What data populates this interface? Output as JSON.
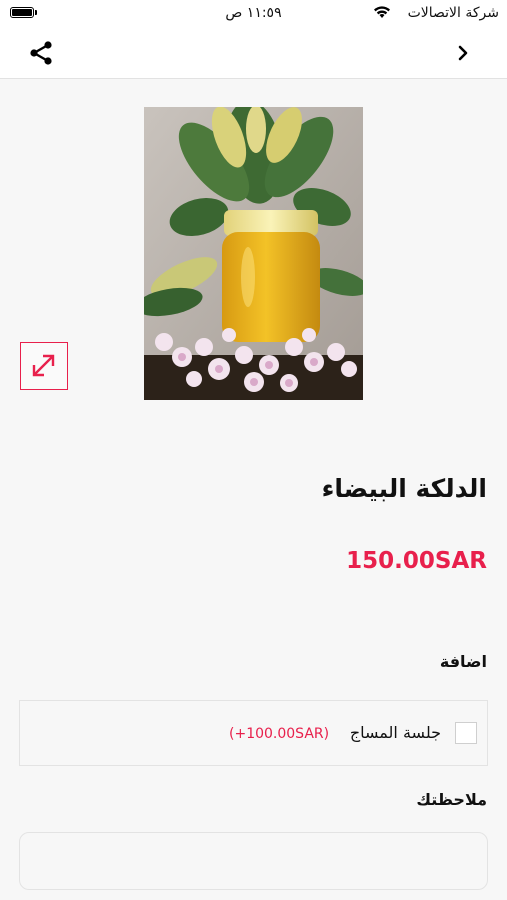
{
  "status_bar": {
    "carrier": "شركة الاتصالات",
    "time": "١١:٥٩ ص"
  },
  "nav": {
    "share_icon": "share-icon",
    "back_icon": "chevron-right-icon"
  },
  "product": {
    "image_description_icon": "product-photo",
    "expand_icon": "expand-arrows-icon",
    "title": "الدلكة البيضاء",
    "price": "150.00SAR"
  },
  "addons": {
    "heading": "اضافة",
    "items": [
      {
        "label": "جلسة المساج",
        "price": "(+100.00SAR)",
        "checked": false
      }
    ]
  },
  "notes": {
    "heading": "ملاحظتك",
    "value": "",
    "placeholder": ""
  },
  "colors": {
    "accent": "#e8204c",
    "background": "#f7f7f7"
  }
}
